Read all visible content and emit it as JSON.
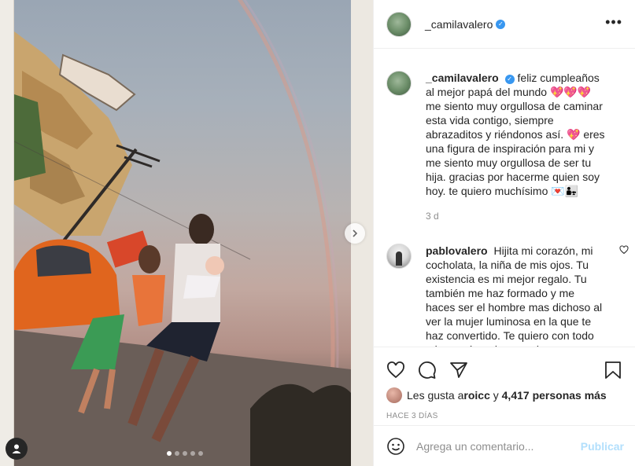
{
  "post": {
    "author": "_camilavalero",
    "more_label": "•••",
    "caption": "feliz cumpleaños al mejor papá del mundo 💖💖💖 me siento muy orgullosa de caminar esta vida contigo, siempre abrazaditos y riéndonos así. 💖 eres una figura de inspiración para mi y me siento muy orgullosa de ser tu hija. gracias por hacerme quien soy hoy. te quiero muchísimo 💌👨‍👧",
    "caption_time": "3 d"
  },
  "comments": [
    {
      "username": "pablovalero",
      "text": "Hijita mi corazón, mi cocholata, la niña de mis ojos. Tu existencia es mi mejor regalo. Tu también me haz formado y me haces ser el hombre mas dichoso al ver la mujer luminosa en la que te haz convertido. Te quiero con todo mi corazón, mi amor, siempre"
    }
  ],
  "likes": {
    "prefix": "Les gusta a ",
    "first_user": "roicc",
    "middle": " y ",
    "others": "4,417 personas más"
  },
  "timestamp": "HACE 3 DÍAS",
  "add_comment": {
    "placeholder": "Agrega un comentario...",
    "publish_label": "Publicar"
  },
  "carousel": {
    "slides": 5,
    "active": 0
  },
  "colors": {
    "accent": "#3897f0",
    "publish_disabled": "#b2dffc",
    "text": "#262626",
    "muted": "#8e8e8e"
  }
}
